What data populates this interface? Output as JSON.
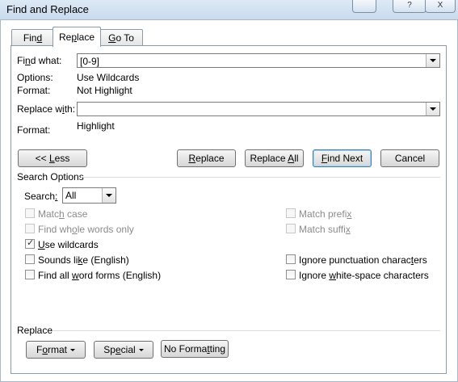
{
  "window": {
    "title": "Find and Replace",
    "tb_buttons": [
      "",
      "?",
      "X"
    ]
  },
  "tabs": [
    {
      "label_pre": "Fin",
      "label_ul": "d",
      "label_post": "",
      "active": false
    },
    {
      "label_pre": "Re",
      "label_ul": "p",
      "label_post": "lace",
      "active": true
    },
    {
      "label_pre": "",
      "label_ul": "G",
      "label_post": "o To",
      "active": false
    }
  ],
  "find": {
    "label_pre": "Fi",
    "label_ul": "n",
    "label_post": "d what:",
    "value": "[0-9]",
    "options_label": "Options:",
    "options_value": "Use Wildcards",
    "format_label": "Format:",
    "format_value": "Not Highlight"
  },
  "replace": {
    "label_pre": "Replace w",
    "label_ul": "i",
    "label_post": "th:",
    "value": "",
    "format_label": "Format:",
    "format_value": "Highlight"
  },
  "buttons": {
    "less_pre": "<< ",
    "less_ul": "L",
    "less_post": "ess",
    "replace_pre": "",
    "replace_ul": "R",
    "replace_post": "eplace",
    "replace_all_pre": "Replace ",
    "replace_all_ul": "A",
    "replace_all_post": "ll",
    "find_next_pre": "",
    "find_next_ul": "F",
    "find_next_post": "ind Next",
    "cancel": "Cancel"
  },
  "search_options": {
    "heading": "Search Options",
    "search_label_pre": "Search",
    "search_label_ul": ":",
    "search_label_post": "",
    "search_value": "All",
    "checkboxes_left": [
      {
        "pre": "Matc",
        "ul": "h",
        "post": " case",
        "checked": false,
        "enabled": false
      },
      {
        "pre": "Find wh",
        "ul": "o",
        "post": "le words only",
        "checked": false,
        "enabled": false
      },
      {
        "pre": "",
        "ul": "U",
        "post": "se wildcards",
        "checked": true,
        "enabled": true
      },
      {
        "pre": "Sounds li",
        "ul": "k",
        "post": "e (English)",
        "checked": false,
        "enabled": true
      },
      {
        "pre": "Find all ",
        "ul": "w",
        "post": "ord forms (English)",
        "checked": false,
        "enabled": true
      }
    ],
    "checkboxes_right": [
      {
        "pre": "Match prefi",
        "ul": "x",
        "post": "",
        "checked": false,
        "enabled": false
      },
      {
        "pre": "Match suffi",
        "ul": "x",
        "post": "",
        "checked": false,
        "enabled": false
      },
      {
        "pre": "Ignore punctuation charac",
        "ul": "t",
        "post": "ers",
        "checked": false,
        "enabled": true
      },
      {
        "pre": "Ignore ",
        "ul": "w",
        "post": "hite-space characters",
        "checked": false,
        "enabled": true
      }
    ]
  },
  "replace_section": {
    "heading": "Replace",
    "format_pre": "F",
    "format_ul": "o",
    "format_post": "rmat",
    "special_pre": "Sp",
    "special_ul": "e",
    "special_post": "cial",
    "no_formatting_pre": "No Forma",
    "no_formatting_ul": "t",
    "no_formatting_post": "ting"
  }
}
